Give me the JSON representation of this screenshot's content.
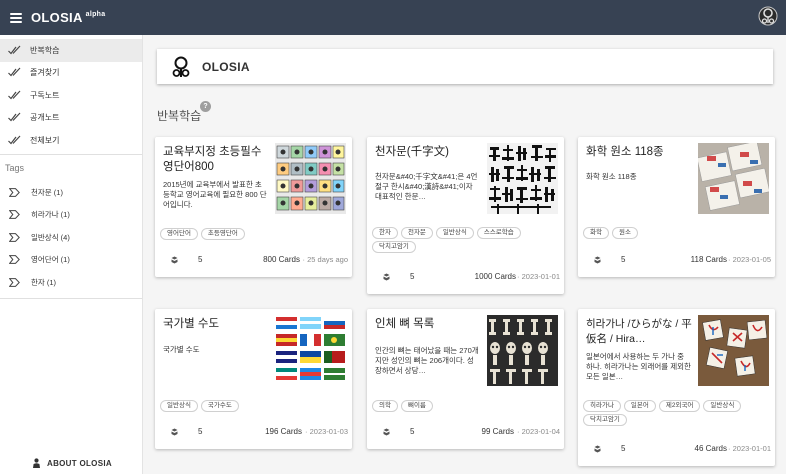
{
  "app": {
    "title": "OLOSIA",
    "badge": "alpha"
  },
  "sidebar": {
    "nav": [
      {
        "label": "반복학습",
        "active": true
      },
      {
        "label": "즐겨찾기"
      },
      {
        "label": "구독노트"
      },
      {
        "label": "공개노트"
      },
      {
        "label": "전체보기"
      }
    ],
    "tags_title": "Tags",
    "tags": [
      {
        "label": "천자문 (1)"
      },
      {
        "label": "히라가나 (1)"
      },
      {
        "label": "일반상식 (4)"
      },
      {
        "label": "영어단어 (1)"
      },
      {
        "label": "한자 (1)"
      }
    ],
    "about": "ABOUT OLOSIA"
  },
  "header": {
    "title": "OLOSIA"
  },
  "section": {
    "title": "반복학습",
    "help": "?"
  },
  "cards": [
    {
      "title": "교육부지정 초등필수영단어800",
      "desc": "2015년에 교육부에서 발표한 초등학교 영어교육에 필요한 800 단어입니다.",
      "tags": [
        "영어단어",
        "초등영단어"
      ],
      "count": "5",
      "cards": "800 Cards",
      "date": "· 25 days ago"
    },
    {
      "title": "천자문(千字文)",
      "desc": "천자문&#40;千字文&#41;은 4언절구 한시&#40;漢詩&#41;이자 대표적인 한문…",
      "tags": [
        "한자",
        "천자문",
        "일반상식",
        "스스로학습",
        "닥치고암기"
      ],
      "count": "5",
      "cards": "1000 Cards",
      "date": "· 2023-01-01"
    },
    {
      "title": "화학 원소 118종",
      "desc": "화학 원소 118종",
      "tags": [
        "화학",
        "원소"
      ],
      "count": "5",
      "cards": "118 Cards",
      "date": "· 2023-01-05"
    },
    {
      "title": "국가별 수도",
      "desc": "국가별 수도",
      "tags": [
        "일반상식",
        "국가수도"
      ],
      "count": "5",
      "cards": "196 Cards",
      "date": "· 2023-01-03"
    },
    {
      "title": "인체 뼈 목록",
      "desc": "인간의 뼈는 태어났을 때는 270개지만 성인의 뼈는 206개이다. 성장하면서 상당…",
      "tags": [
        "의학",
        "뼈이름"
      ],
      "count": "5",
      "cards": "99 Cards",
      "date": "· 2023-01-04"
    },
    {
      "title": "히라가나 /ひらがな / 平仮名 / Hira…",
      "desc": "일본어에서 사용하는 두 가나 중 하나. 히라가나는 외래어를 제외한 모든 일본…",
      "tags": [
        "히라가나",
        "일본어",
        "제2외국어",
        "일반상식",
        "닥치고암기"
      ],
      "count": "5",
      "cards": "46 Cards",
      "date": "· 2023-01-01"
    }
  ],
  "colors": {
    "topbar": "#374253",
    "background": "#f5f5f5",
    "active_nav": "#ebebeb"
  },
  "icons": {
    "menu": "hamburger-icon",
    "nav": "double-check-icon",
    "tag": "label-outline-icon",
    "deck": "deck-icon",
    "about": "person-icon",
    "logo": "olosia-logo-icon"
  }
}
